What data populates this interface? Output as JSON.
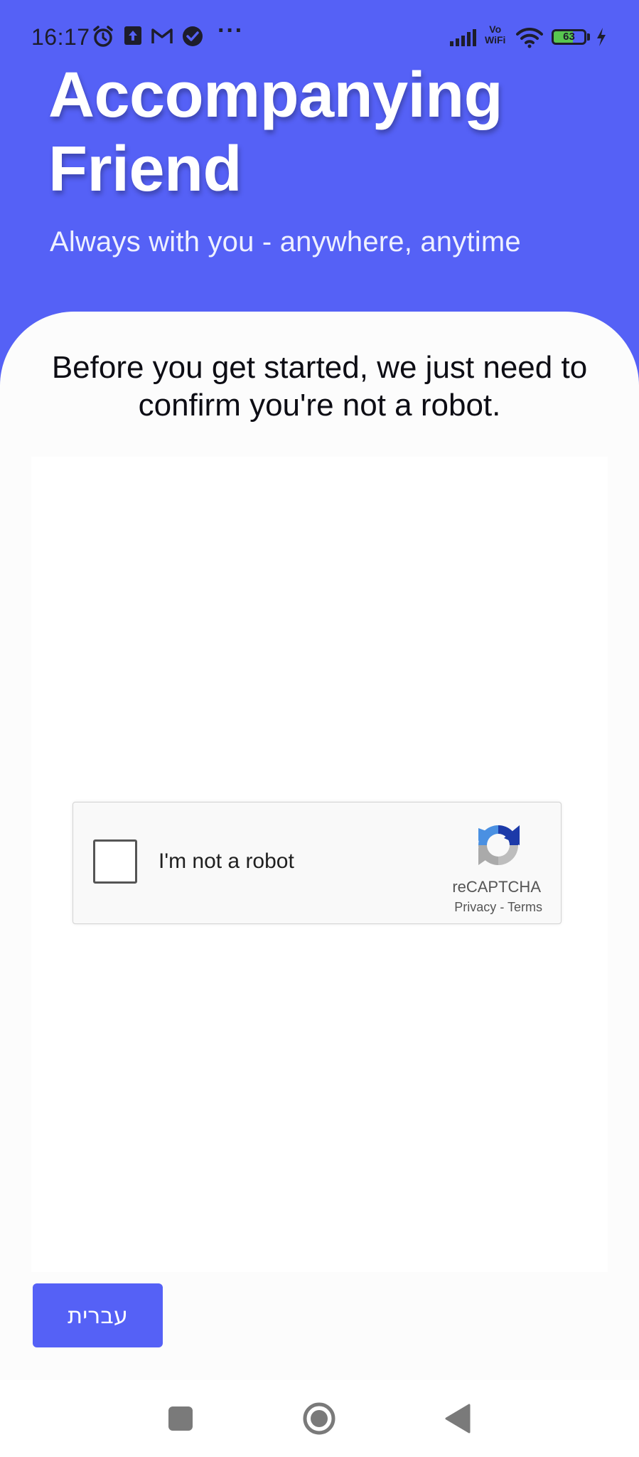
{
  "status_bar": {
    "time": "16:17",
    "dots": "···",
    "vowifi_top": "Vo",
    "vowifi_bottom": "WiFi",
    "battery_level": "63",
    "battery_fraction": 0.63,
    "icons": [
      "alarm-icon",
      "upload-icon",
      "gmail-icon",
      "check-badge-icon",
      "signal-icon",
      "wifi-icon",
      "battery-icon",
      "charging-icon"
    ]
  },
  "header": {
    "title": "Accompanying Friend",
    "subtitle": "Always with you - anywhere, anytime"
  },
  "verification": {
    "prompt": "Before you get started, we just need to confirm you're not a robot.",
    "checkbox_label": "I'm not a robot",
    "brand": "reCAPTCHA",
    "privacy_link": "Privacy",
    "separator": "-",
    "terms_link": "Terms"
  },
  "language_button": {
    "label": "עברית"
  },
  "navigation": {
    "buttons": [
      "recent-apps",
      "home",
      "back"
    ]
  },
  "colors": {
    "primary": "#5561f6",
    "background": "#fcfcfc",
    "battery_fill": "#58c64f"
  }
}
